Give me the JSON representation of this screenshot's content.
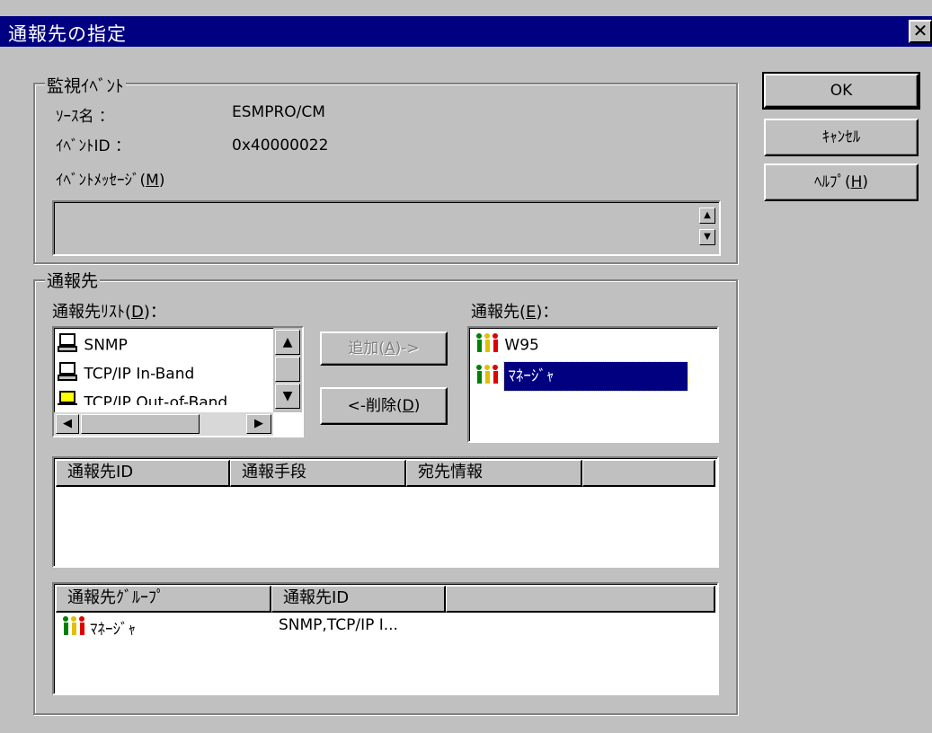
{
  "window": {
    "title": "通報先の指定",
    "close_glyph": "✕"
  },
  "buttons": {
    "ok": "OK",
    "cancel": "ｷｬﾝｾﾙ",
    "help": "ﾍﾙﾌﾟ(H)"
  },
  "event_group": {
    "label": "監視ｲﾍﾞﾝﾄ",
    "source_label": "ｿｰｽ名 ：",
    "source_value": "ESMPRO/CM",
    "event_id_label": "ｲﾍﾞﾝﾄID ：",
    "event_id_value": "0x40000022",
    "message_label": "ｲﾍﾞﾝﾄﾒｯｾｰｼﾞ(M)",
    "message_value": ""
  },
  "dest_group": {
    "label": "通報先",
    "list_label": "通報先ﾘｽﾄ(D)：",
    "list_items": [
      {
        "text": "SNMP",
        "icon": "computer-icon"
      },
      {
        "text": "TCP/IP In-Band",
        "icon": "computer-icon"
      },
      {
        "text": "TCP/IP Out-of-Band",
        "icon": "computer-yellow-icon"
      }
    ],
    "add_button": "追加(A)->",
    "remove_button": "<-削除(D)",
    "selected_label": "通報先(E)：",
    "selected_items": [
      {
        "text": "W95",
        "icon": "people-icon",
        "selected": false
      },
      {
        "text": "ﾏﾈｰｼﾞｬ",
        "icon": "people-icon",
        "selected": true
      }
    ]
  },
  "detail_table": {
    "columns": [
      "通報先ID",
      "通報手段",
      "宛先情報",
      ""
    ],
    "rows": []
  },
  "group_table": {
    "columns": [
      "通報先ｸﾞﾙｰﾌﾟ",
      "通報先ID",
      ""
    ],
    "rows": [
      {
        "group": "ﾏﾈｰｼﾞｬ",
        "ids": "SNMP,TCP/IP I..."
      }
    ]
  },
  "colors": {
    "face": "#c0c0c0",
    "title_bar": "#000080",
    "selection": "#000080"
  }
}
